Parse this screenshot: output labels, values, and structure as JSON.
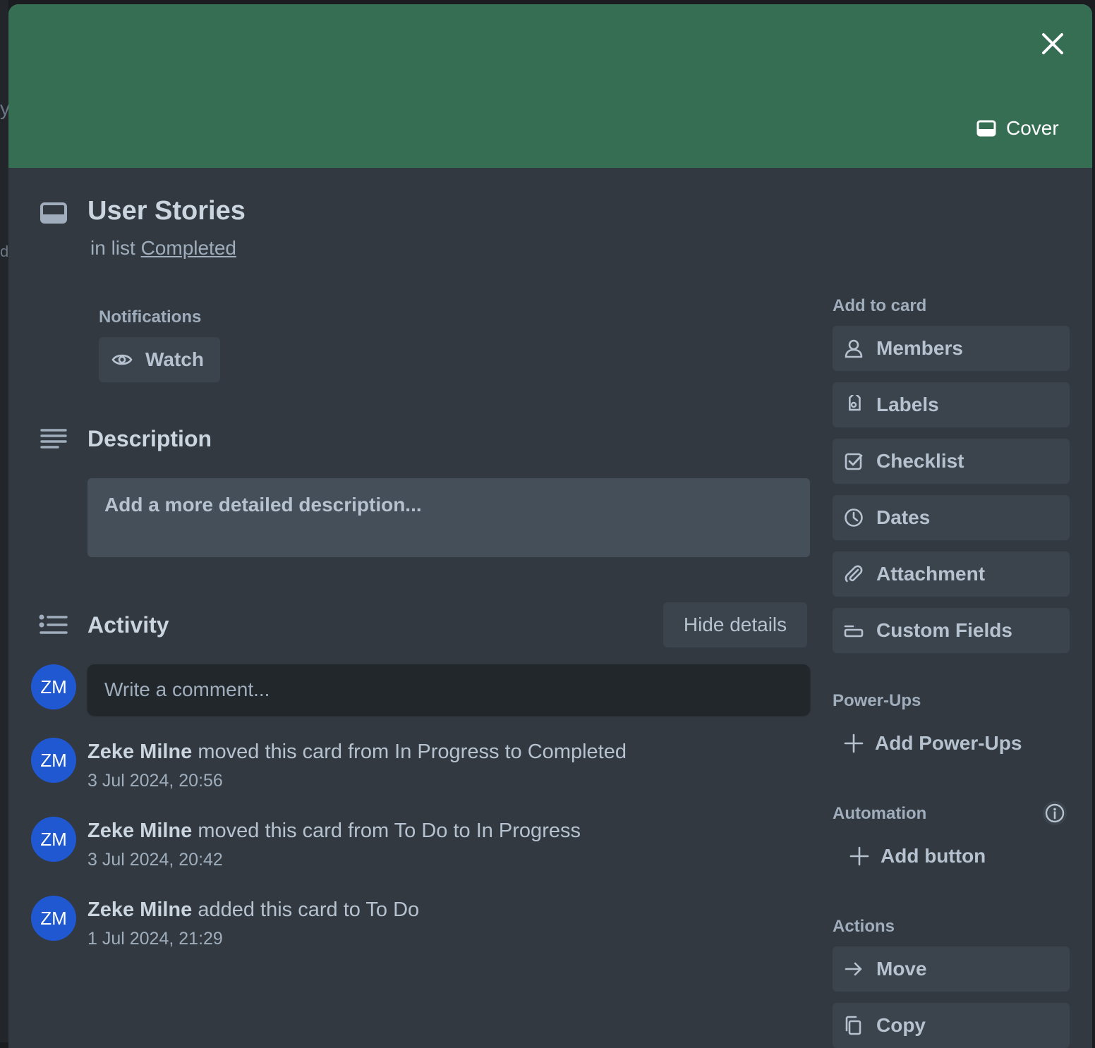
{
  "cover": {
    "button_label": "Cover",
    "color": "#356e53"
  },
  "card": {
    "title": "User Stories",
    "list_prefix": "in list",
    "list_name": "Completed"
  },
  "notifications": {
    "heading": "Notifications",
    "watch_label": "Watch"
  },
  "description": {
    "heading": "Description",
    "placeholder": "Add a more detailed description..."
  },
  "activity": {
    "heading": "Activity",
    "toggle_label": "Hide details",
    "comment_placeholder": "Write a comment...",
    "current_user_initials": "ZM",
    "items": [
      {
        "initials": "ZM",
        "user": "Zeke Milne",
        "text": "moved this card from In Progress to Completed",
        "time": "3 Jul 2024, 20:56"
      },
      {
        "initials": "ZM",
        "user": "Zeke Milne",
        "text": "moved this card from To Do to In Progress",
        "time": "3 Jul 2024, 20:42"
      },
      {
        "initials": "ZM",
        "user": "Zeke Milne",
        "text": "added this card to To Do",
        "time": "1 Jul 2024, 21:29"
      }
    ]
  },
  "sidebar": {
    "add_to_card": {
      "heading": "Add to card",
      "items": [
        {
          "label": "Members",
          "icon": "person-icon"
        },
        {
          "label": "Labels",
          "icon": "tag-icon"
        },
        {
          "label": "Checklist",
          "icon": "checkbox-icon"
        },
        {
          "label": "Dates",
          "icon": "clock-icon"
        },
        {
          "label": "Attachment",
          "icon": "paperclip-icon"
        },
        {
          "label": "Custom Fields",
          "icon": "custom-fields-icon"
        }
      ]
    },
    "power_ups": {
      "heading": "Power-Ups",
      "add_label": "Add Power-Ups"
    },
    "automation": {
      "heading": "Automation",
      "add_label": "Add button"
    },
    "actions": {
      "heading": "Actions",
      "items": [
        {
          "label": "Move",
          "icon": "arrow-right-icon"
        },
        {
          "label": "Copy",
          "icon": "copy-icon"
        }
      ]
    }
  },
  "background": {
    "partial_chars": [
      "y",
      "d"
    ]
  },
  "colors": {
    "modal_bg": "#323940",
    "button_bg": "#3b434c",
    "avatar_bg": "#1f58d0"
  }
}
